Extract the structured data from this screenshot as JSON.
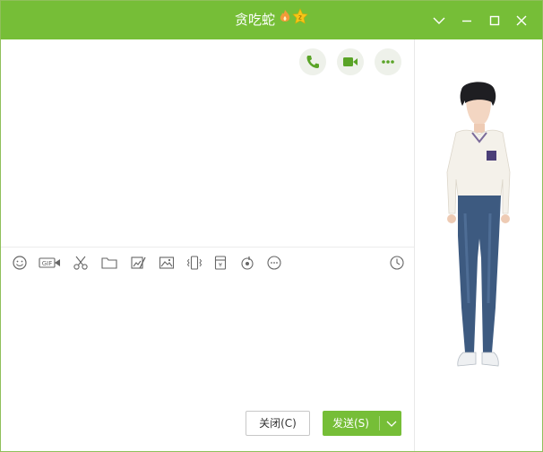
{
  "window": {
    "title": "贪吃蛇",
    "controls": [
      "chevron-down-icon",
      "minimize-icon",
      "maximize-icon",
      "close-icon"
    ]
  },
  "top_actions": [
    "phone-icon",
    "video-call-icon",
    "more-icon"
  ],
  "toolbar": {
    "tools": [
      "emoji-icon",
      "gif-icon",
      "scissors-icon",
      "folder-icon",
      "image-edit-icon",
      "image-icon",
      "shake-icon",
      "red-packet-icon",
      "music-icon",
      "more-circle-icon",
      "history-icon"
    ]
  },
  "buttons": {
    "close_label": "关闭(C)",
    "send_label": "发送(S)"
  },
  "colors": {
    "accent": "#76be37",
    "icon": "#666666",
    "green_icon": "#5aa427"
  }
}
